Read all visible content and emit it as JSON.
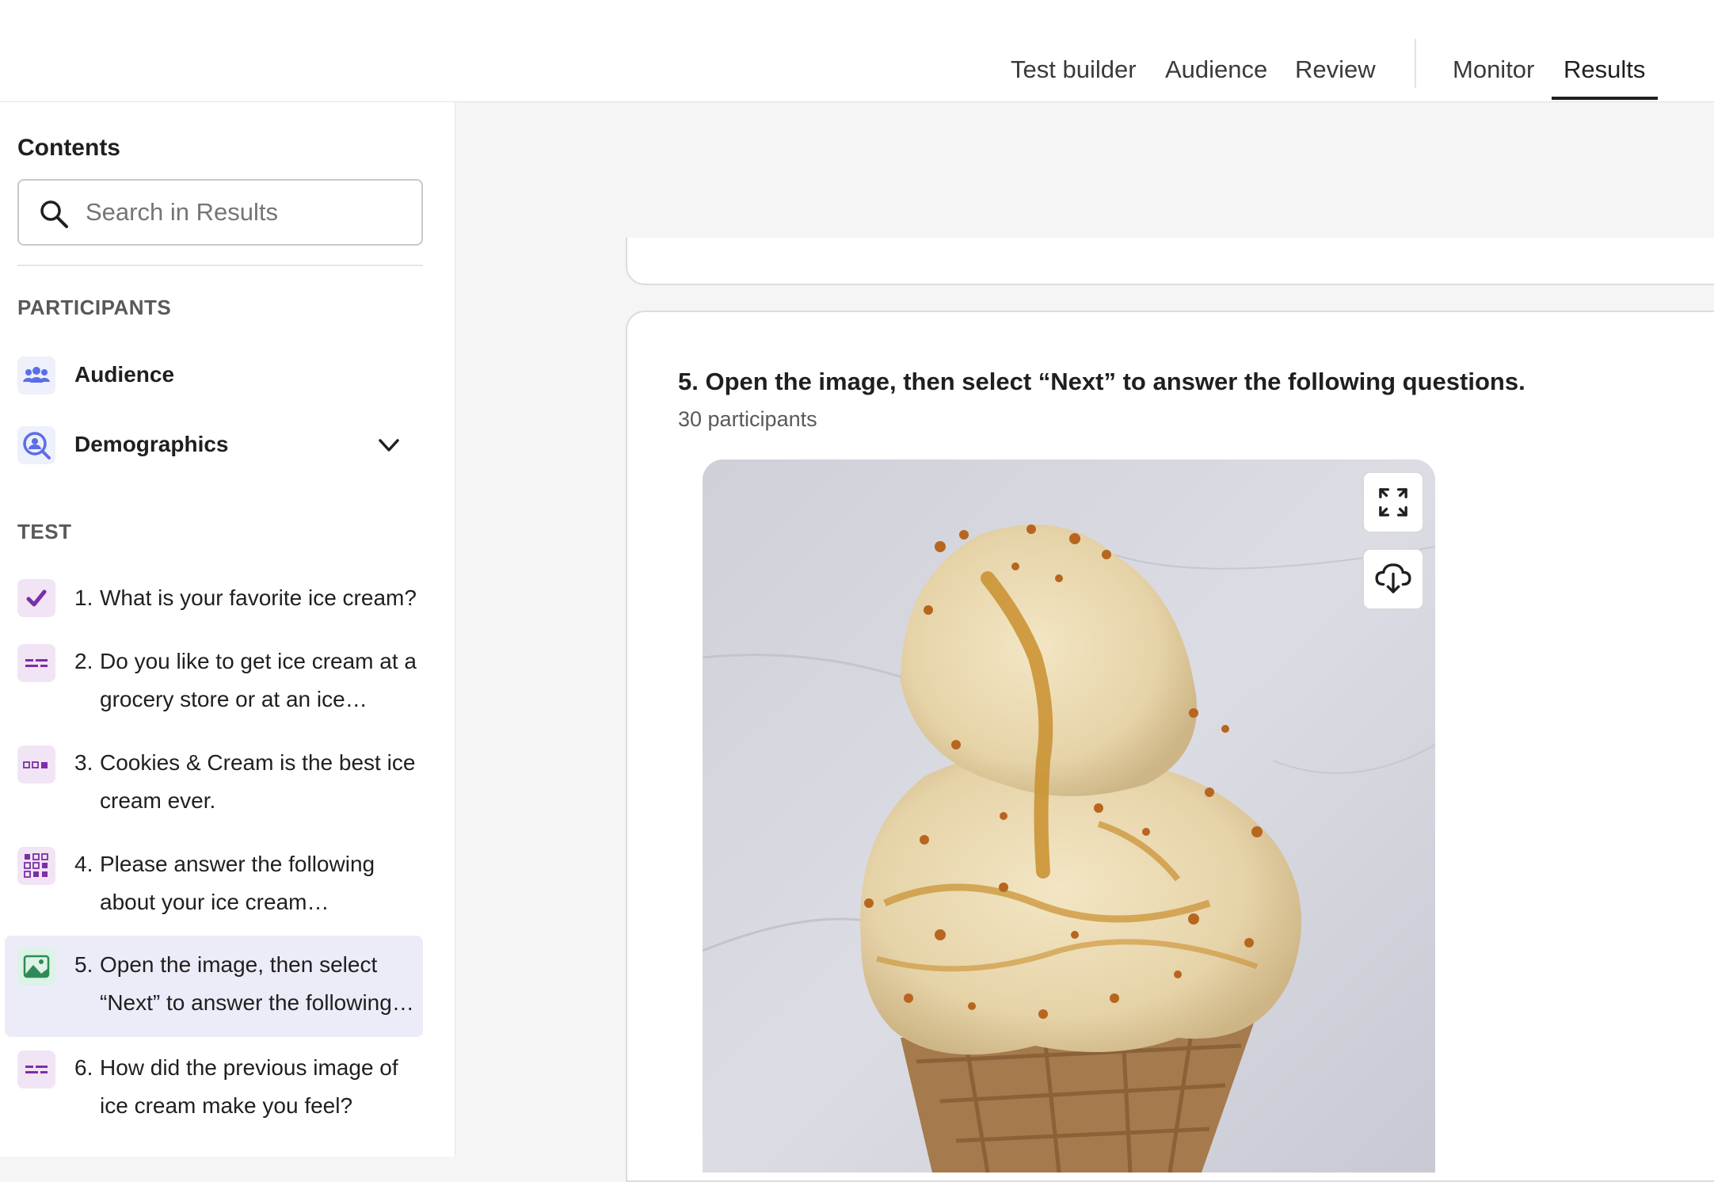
{
  "nav": {
    "tabs": [
      "Test builder",
      "Audience",
      "Review"
    ],
    "tabs_right": [
      "Monitor",
      "Results"
    ],
    "active_tab": "Results"
  },
  "sidebar": {
    "title": "Contents",
    "search_placeholder": "Search in Results",
    "participants_label": "PARTICIPANTS",
    "participant_items": [
      {
        "label": "Audience",
        "icon": "people-group-icon"
      },
      {
        "label": "Demographics",
        "icon": "person-search-icon",
        "expandable": true
      }
    ],
    "test_label": "TEST",
    "questions": [
      {
        "num": "1.",
        "text": "What is your favorite ice cream?",
        "icon": "checkbox-icon"
      },
      {
        "num": "2.",
        "text": "Do you like to get ice cream at a grocery store or at an ice…",
        "icon": "text-lines-icon"
      },
      {
        "num": "3.",
        "text": "Cookies & Cream is the best ice cream ever.",
        "icon": "rating-scale-icon"
      },
      {
        "num": "4.",
        "text": "Please answer the following about your ice cream…",
        "icon": "matrix-grid-icon"
      },
      {
        "num": "5.",
        "text": "Open the image, then select “Next” to answer the following…",
        "icon": "image-icon",
        "active": true
      },
      {
        "num": "6.",
        "text": "How did the previous image of ice cream make you feel?",
        "icon": "text-lines-icon"
      }
    ]
  },
  "main": {
    "question_title": "5. Open the image, then select “Next” to answer the following questions.",
    "participants_count": "30 participants",
    "image_alt": "Ice cream cone with caramel drizzle and toffee bits",
    "tools": [
      "expand-icon",
      "download-cloud-icon"
    ]
  },
  "colors": {
    "accent_purple": "#7b2fa8",
    "active_bg": "#ececf9",
    "audience_icon": "#5b6ee8",
    "image_icon_green": "#2e8b57"
  }
}
